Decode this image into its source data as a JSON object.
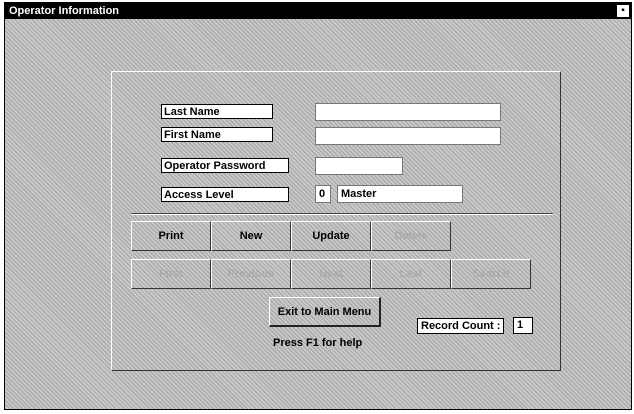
{
  "window": {
    "title": "Operator Information"
  },
  "form": {
    "last_name_label": "Last Name",
    "last_name_value": "",
    "first_name_label": "First Name",
    "first_name_value": "",
    "password_label": "Operator Password",
    "password_value": "",
    "access_level_label": "Access Level",
    "access_level_code": "0",
    "access_level_name": "Master"
  },
  "buttons_row1": {
    "print": "Print",
    "new": "New",
    "update": "Update",
    "delete": "Delete"
  },
  "buttons_row2": {
    "first": "First",
    "previous": "Previous",
    "next": "Next",
    "last": "Last",
    "search": "Search"
  },
  "exit_label": "Exit to Main Menu",
  "help_text": "Press F1 for help",
  "record_count": {
    "label": "Record Count :",
    "value": "1"
  }
}
